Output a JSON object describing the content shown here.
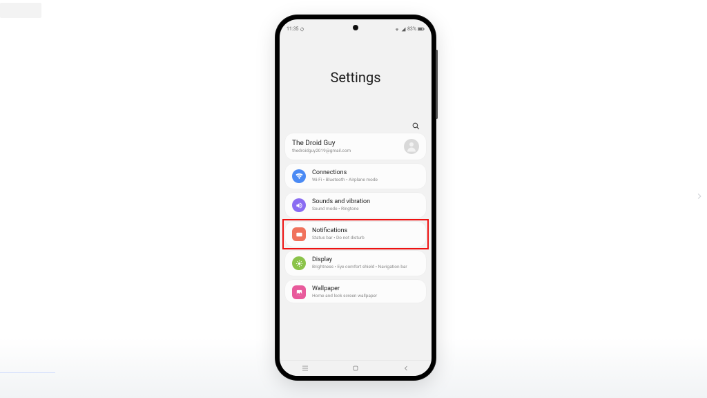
{
  "statusbar": {
    "time": "11:35",
    "battery": "83%"
  },
  "header": {
    "title": "Settings"
  },
  "account": {
    "name": "The Droid Guy",
    "email": "thedroidguy2019@gmail.com"
  },
  "items": [
    {
      "id": "connections",
      "title": "Connections",
      "sub": "Wi-Fi • Bluetooth • Airplane mode",
      "color": "#4a8af4"
    },
    {
      "id": "sounds",
      "title": "Sounds and vibration",
      "sub": "Sound mode • Ringtone",
      "color": "#8a6cf2"
    },
    {
      "id": "notifications",
      "title": "Notifications",
      "sub": "Status bar • Do not disturb",
      "color": "#f0725c",
      "highlight": true
    },
    {
      "id": "display",
      "title": "Display",
      "sub": "Brightness • Eye comfort shield • Navigation bar",
      "color": "#8bc34a"
    },
    {
      "id": "wallpaper",
      "title": "Wallpaper",
      "sub": "Home and lock screen wallpaper",
      "color": "#e85a9b"
    }
  ]
}
